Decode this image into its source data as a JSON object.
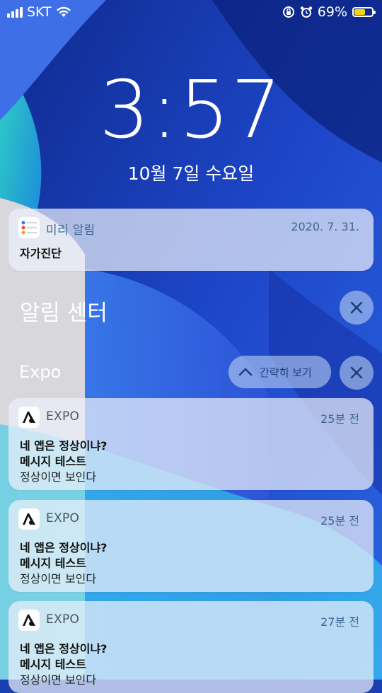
{
  "status_bar": {
    "carrier": "SKT",
    "battery_percent": "69%",
    "battery_level": 0.69,
    "battery_color": "#f6d40a",
    "icons": [
      "signal-icon",
      "wifi-icon",
      "rotation-lock-icon",
      "alarm-icon",
      "battery-icon"
    ]
  },
  "lock_screen": {
    "time": "3:57",
    "date": "10월 7일 수요일"
  },
  "reminder_notification": {
    "app_name": "미리 알림",
    "timestamp": "2020. 7. 31.",
    "title": "자가진단",
    "icon": "reminders-app-icon"
  },
  "notification_center": {
    "title": "알림 센터",
    "clear_icon": "close-icon"
  },
  "expo_group": {
    "title": "Expo",
    "collapse_label": "간략히 보기",
    "collapse_icon": "chevron-up-icon",
    "clear_icon": "close-icon",
    "notifications": [
      {
        "app_name": "EXPO",
        "time": "25분 전",
        "title": "네 앱은 정상이냐?",
        "subtitle": "메시지 테스트",
        "body": "정상이면 보인다"
      },
      {
        "app_name": "EXPO",
        "time": "25분 전",
        "title": "네 앱은 정상이냐?",
        "subtitle": "메시지 테스트",
        "body": "정상이면 보인다"
      },
      {
        "app_name": "EXPO",
        "time": "27분 전",
        "title": "네 앱은 정상이냐?",
        "subtitle": "메시지 테스트",
        "body": "정상이면 보인다"
      }
    ]
  }
}
